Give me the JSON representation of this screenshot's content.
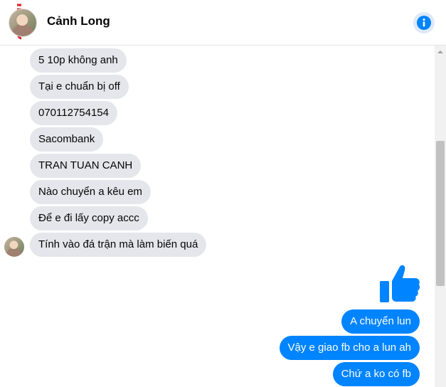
{
  "header": {
    "contact_name": "Cảnh Long",
    "watermark_text": "INFO",
    "info_icon": "info-icon"
  },
  "messages": [
    {
      "side": "in",
      "text": "5 10p không anh"
    },
    {
      "side": "in",
      "text": "Tại e chuẩn bị off"
    },
    {
      "side": "in",
      "text": "070112754154"
    },
    {
      "side": "in",
      "text": "Sacombank"
    },
    {
      "side": "in",
      "text": "TRAN TUAN CANH"
    },
    {
      "side": "in",
      "text": "Nào chuyển a kêu em"
    },
    {
      "side": "in",
      "text": "Để e đi lấy copy accc"
    },
    {
      "side": "in",
      "text": "Tính vào đá trận mà làm biến quá"
    },
    {
      "side": "out",
      "type": "like",
      "icon": "thumbs-up-icon"
    },
    {
      "side": "out",
      "text": "A chuyển lun"
    },
    {
      "side": "out",
      "text": "Vậy e giao fb cho a lun ah"
    },
    {
      "side": "out",
      "text": "Chứ a ko có fb"
    }
  ],
  "colors": {
    "outgoing_bubble": "#0084ff",
    "incoming_bubble": "#e4e6eb",
    "watermark": "#e02424"
  }
}
